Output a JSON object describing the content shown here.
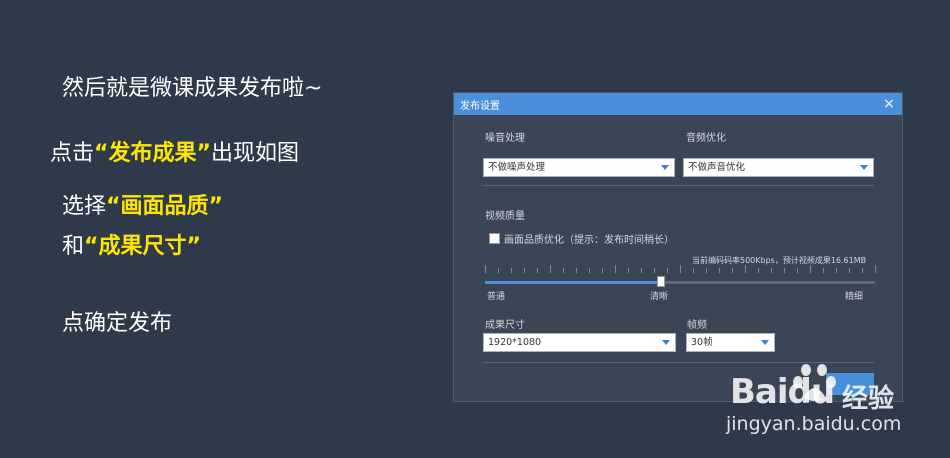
{
  "slide": {
    "line1": "然后就是微课成果发布啦~",
    "line2_pre": "点击",
    "line2_hl": "“发布成果”",
    "line2_post": "出现如图",
    "line3_pre": "选择",
    "line3_hl": "“画面品质”",
    "line4_pre": "和",
    "line4_hl": "“成果尺寸”",
    "line5": "点确定发布"
  },
  "dialog": {
    "title": "发布设置",
    "close_icon": "×",
    "noise_label": "噪音处理",
    "noise_value": "不做噪声处理",
    "audio_label": "音频优化",
    "audio_value": "不做声音优化",
    "video_quality_label": "视频质量",
    "quality_opt_label": "画面品质优化（提示：发布时间稍长）",
    "bitrate_info": "当前编码码率500Kbps，预计视频成果16.61MB",
    "slider": {
      "position": 0.45,
      "labels": [
        "普通",
        "清晰",
        "精细"
      ]
    },
    "size_label": "成果尺寸",
    "size_value": "1920*1080",
    "fps_label": "帧频",
    "fps_value": "30帧"
  },
  "watermark": {
    "logo": "Baidu",
    "cn": "经验",
    "url": "jingyan.baidu.com"
  },
  "colors": {
    "background": "#2e3a4a",
    "highlight": "#ffe600",
    "dialog_title": "#4a8fd9"
  }
}
